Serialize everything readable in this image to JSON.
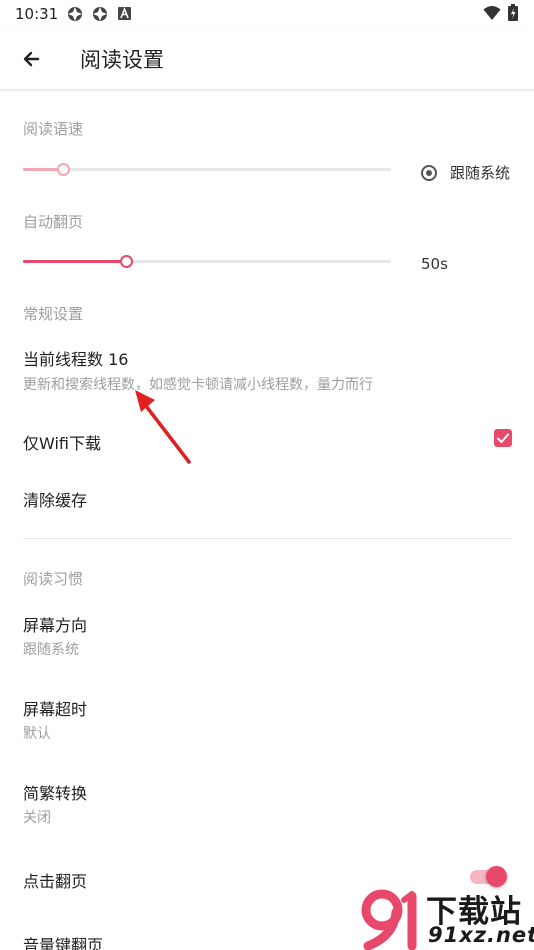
{
  "status_bar": {
    "time": "10:31",
    "left_icons": [
      "settings-sync-icon",
      "settings-sync-icon",
      "font-a-icon"
    ],
    "right_icons": [
      "wifi-icon",
      "battery-icon"
    ]
  },
  "app_bar": {
    "back_icon": "arrow-back-icon",
    "title": "阅读设置"
  },
  "reading_speed": {
    "header": "阅读语速",
    "slider_value": 0.11,
    "follow_system_label": "跟随系统",
    "follow_system_selected": true
  },
  "auto_page": {
    "header": "自动翻页",
    "slider_value": 0.28,
    "value_label": "50s"
  },
  "general": {
    "header": "常规设置",
    "thread_title": "当前线程数 16",
    "thread_subtitle": "更新和搜索线程数，如感觉卡顿请减小线程数，量力而行",
    "wifi_only_title": "仅Wifi下载",
    "wifi_only_checked": true,
    "clear_cache_title": "清除缓存"
  },
  "habits": {
    "header": "阅读习惯",
    "orientation_title": "屏幕方向",
    "orientation_value": "跟随系统",
    "timeout_title": "屏幕超时",
    "timeout_value": "默认",
    "convert_title": "简繁转换",
    "convert_value": "关闭",
    "tap_page_title": "点击翻页",
    "tap_page_on": true,
    "volume_page_title": "音量键翻页"
  },
  "watermark": {
    "brand": "下载站",
    "url": "91xz.net",
    "logo_text": "91"
  },
  "colors": {
    "accent": "#e8486a",
    "accent_light": "#f3a6b6",
    "annotation_red": "#e02020"
  }
}
